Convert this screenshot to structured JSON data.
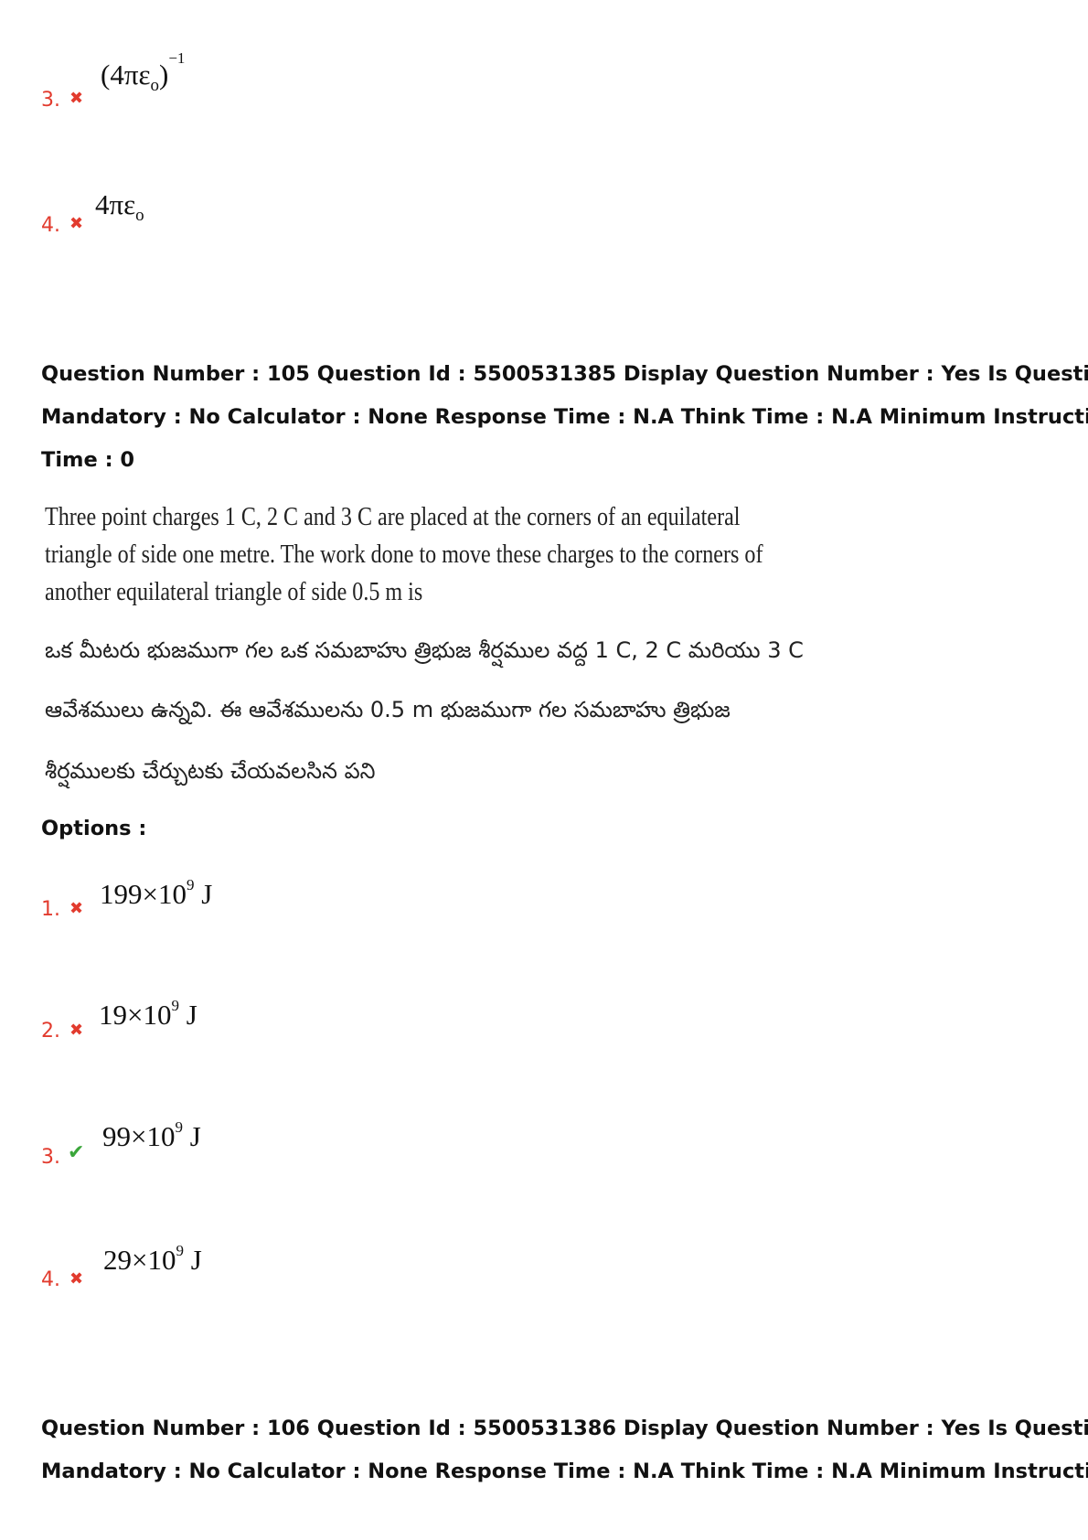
{
  "prev_options": [
    {
      "num": "3.",
      "mark": "✖",
      "correct": false,
      "parts": [
        "(4πε",
        "o",
        ")",
        "−1"
      ]
    },
    {
      "num": "4.",
      "mark": "✖",
      "correct": false,
      "parts": [
        "4πε",
        "o"
      ]
    }
  ],
  "question_105": {
    "meta_lines": [
      "Question Number : 105 Question Id : 5500531385 Display Question Number : Yes Is Question",
      "Mandatory : No Calculator : None Response Time : N.A Think Time : N.A Minimum Instruction",
      "Time : 0"
    ],
    "text_en_lines": [
      "Three point charges 1 C, 2 C and 3 C are placed at the corners of an equilateral",
      "triangle of side one metre. The work done to move these charges to the corners of",
      "another equilateral triangle of side 0.5 m is"
    ],
    "text_te_lines": [
      "ఒక మీటరు  భుజముగా గల ఒక సమబాహు త్రిభుజ శీర్షముల వద్ద 1 C, 2 C మరియు 3 C",
      "ఆవేశములు ఉన్నవి. ఈ ఆవేశములను 0.5 m భుజముగా గల సమబాహు త్రిభుజ",
      "శీర్షములకు చేర్చుటకు చేయవలసిన పని"
    ],
    "options_label": "Options :",
    "options": [
      {
        "num": "1.",
        "mark": "✖",
        "correct": false,
        "base": "199×10",
        "exp": "9",
        "unit": " J"
      },
      {
        "num": "2.",
        "mark": "✖",
        "correct": false,
        "base": "19×10",
        "exp": "9",
        "unit": " J"
      },
      {
        "num": "3.",
        "mark": "✔",
        "correct": true,
        "base": "99×10",
        "exp": "9",
        "unit": " J"
      },
      {
        "num": "4.",
        "mark": "✖",
        "correct": false,
        "base": "29×10",
        "exp": "9",
        "unit": " J"
      }
    ]
  },
  "question_106": {
    "meta_lines": [
      "Question Number : 106 Question Id : 5500531386 Display Question Number : Yes Is Question",
      "Mandatory : No Calculator : None Response Time : N.A Think Time : N.A Minimum Instruction"
    ]
  }
}
